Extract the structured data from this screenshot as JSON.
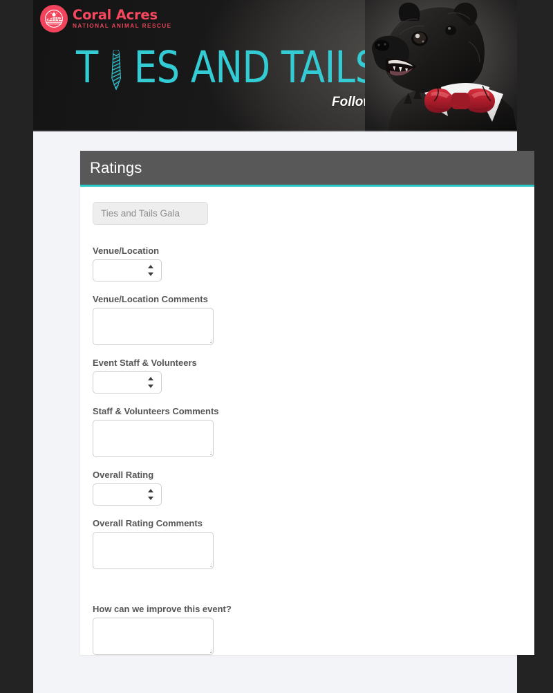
{
  "banner": {
    "logo": {
      "mark_icon": "sunrise-field-circle-icon",
      "wordmark": "Coral Acres",
      "tagline": "NATIONAL ANIMAL RESCUE",
      "brand_color": "#f2455c"
    },
    "headline_part_1": "T",
    "headline_tie_icon": "necktie-icon",
    "headline_part_2": "ES AND TAILS GALA",
    "headline_full": "TIES AND TAILS GALA",
    "subheadline": "Follow Up Survey",
    "headline_color": "#33ccd4",
    "photo": {
      "name": "dog-in-bowtie-photo",
      "description": "black scruffy dog wearing red bow tie and white collar",
      "bowtie_color": "#b51f2e"
    }
  },
  "card": {
    "title": "Ratings",
    "title_bar_color": "#585858",
    "accent_color": "#28c8c8",
    "event_name_field": {
      "value": "Ties and Tails Gala",
      "disabled": true
    },
    "fields": [
      {
        "id": "venue-location",
        "label": "Venue/Location",
        "type": "select",
        "value": "",
        "options": []
      },
      {
        "id": "venue-location-comments",
        "label": "Venue/Location Comments",
        "type": "textarea",
        "value": "",
        "placeholder": ""
      },
      {
        "id": "event-staff-volunteers",
        "label": "Event Staff & Volunteers",
        "type": "select",
        "value": "",
        "options": []
      },
      {
        "id": "staff-volunteers-comments",
        "label": "Staff & Volunteers Comments",
        "type": "textarea",
        "value": "",
        "placeholder": ""
      },
      {
        "id": "overall-rating",
        "label": "Overall Rating",
        "type": "select",
        "value": "",
        "options": []
      },
      {
        "id": "overall-rating-comments",
        "label": "Overall Rating Comments",
        "type": "textarea",
        "value": "",
        "placeholder": ""
      },
      {
        "id": "how-can-we-improve",
        "label": "How can we improve this event?",
        "type": "textarea",
        "value": "",
        "placeholder": ""
      }
    ]
  }
}
